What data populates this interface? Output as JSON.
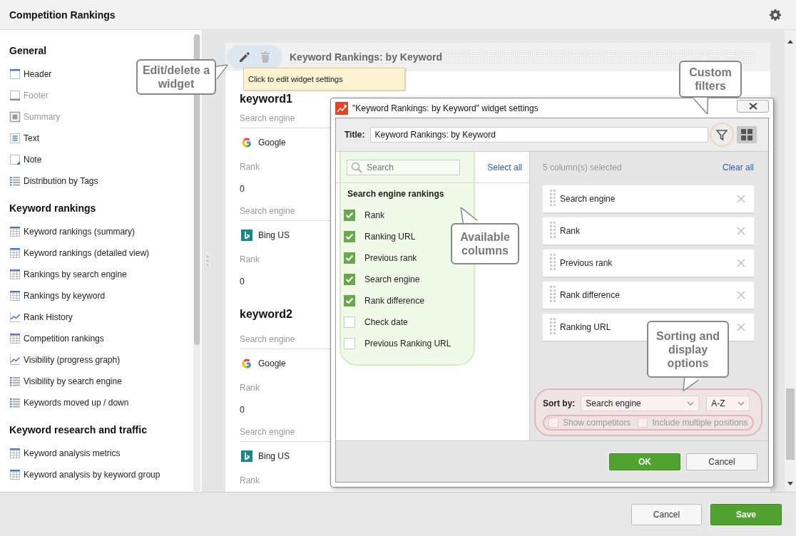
{
  "header": {
    "title": "Competition Rankings"
  },
  "sidebar": {
    "sections": [
      {
        "title": "General",
        "items": [
          {
            "label": "Header",
            "kind": "header",
            "disabled": false
          },
          {
            "label": "Footer",
            "kind": "footer",
            "disabled": true
          },
          {
            "label": "Summary",
            "kind": "summary",
            "disabled": true
          },
          {
            "label": "Text",
            "kind": "text",
            "disabled": false
          },
          {
            "label": "Note",
            "kind": "note",
            "disabled": false
          },
          {
            "label": "Distribution by Tags",
            "kind": "list",
            "disabled": false
          }
        ]
      },
      {
        "title": "Keyword rankings",
        "items": [
          {
            "label": "Keyword rankings (summary)",
            "kind": "table",
            "disabled": false
          },
          {
            "label": "Keyword rankings (detailed view)",
            "kind": "table",
            "disabled": false
          },
          {
            "label": "Rankings by search engine",
            "kind": "table",
            "disabled": false
          },
          {
            "label": "Rankings by keyword",
            "kind": "table",
            "disabled": false
          },
          {
            "label": "Rank History",
            "kind": "chart",
            "disabled": false
          },
          {
            "label": "Competition rankings",
            "kind": "table",
            "disabled": false
          },
          {
            "label": "Visibility (progress graph)",
            "kind": "chart",
            "disabled": false
          },
          {
            "label": "Visibility by search engine",
            "kind": "list",
            "disabled": false
          },
          {
            "label": "Keywords moved up / down",
            "kind": "list",
            "disabled": false
          }
        ]
      },
      {
        "title": "Keyword research and traffic",
        "items": [
          {
            "label": "Keyword analysis metrics",
            "kind": "table",
            "disabled": false
          },
          {
            "label": "Keyword analysis by keyword group",
            "kind": "table",
            "disabled": false
          }
        ]
      }
    ]
  },
  "widget": {
    "title": "Keyword Rankings: by Keyword",
    "tooltip": "Click to edit widget settings",
    "keywords": [
      {
        "name": "keyword1",
        "engines": [
          {
            "header": "Search engine",
            "engine": "Google",
            "kind": "google",
            "metric": "Rank",
            "value": "0"
          },
          {
            "header": "Search engine",
            "engine": "Bing US",
            "kind": "bing",
            "metric": "Rank",
            "value": "0"
          }
        ]
      },
      {
        "name": "keyword2",
        "engines": [
          {
            "header": "Search engine",
            "engine": "Google",
            "kind": "google",
            "metric": "Rank",
            "value": "0"
          },
          {
            "header": "Search engine",
            "engine": "Bing US",
            "kind": "bing",
            "metric": "Rank"
          }
        ]
      }
    ]
  },
  "dialog": {
    "title": "\"Keyword Rankings: by Keyword\" widget settings",
    "title_label": "Title:",
    "title_value": "Keyword Rankings: by Keyword",
    "search_placeholder": "Search",
    "select_all": "Select all",
    "group": "Search engine rankings",
    "available": [
      {
        "label": "Rank",
        "checked": true
      },
      {
        "label": "Ranking URL",
        "checked": true
      },
      {
        "label": "Previous rank",
        "checked": true
      },
      {
        "label": "Search engine",
        "checked": true
      },
      {
        "label": "Rank difference",
        "checked": true
      },
      {
        "label": "Check date",
        "checked": false
      },
      {
        "label": "Previous Ranking URL",
        "checked": false
      }
    ],
    "selected_count": "5 column(s) selected",
    "clear_all": "Clear all",
    "selected_columns": [
      "Search engine",
      "Rank",
      "Previous rank",
      "Rank difference",
      "Ranking URL"
    ],
    "sort_label": "Sort by:",
    "sort_value": "Search engine",
    "order_value": "A-Z",
    "options": [
      {
        "label": "Show competitors",
        "checked": false
      },
      {
        "label": "Include multiple positions",
        "checked": false
      }
    ],
    "ok": "OK",
    "cancel": "Cancel"
  },
  "callouts": [
    "Edit/delete a widget",
    "Custom filters",
    "Available columns",
    "Sorting and display options"
  ],
  "footer": {
    "buttons": [
      {
        "label": "Cancel",
        "kind": "secondary"
      },
      {
        "label": "Save",
        "kind": "primary"
      }
    ]
  }
}
